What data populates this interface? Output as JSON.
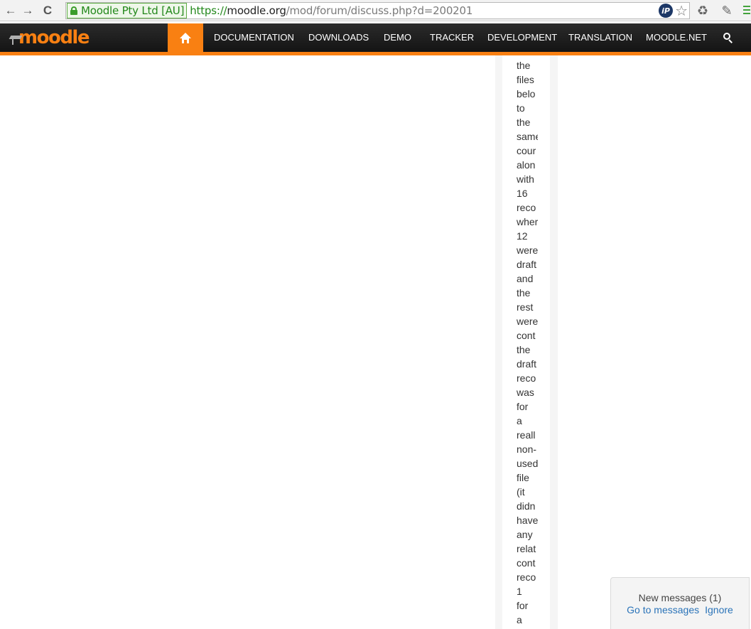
{
  "browser": {
    "ev_label": "Moodle Pty Ltd [AU]",
    "url_scheme": "https://",
    "url_host": "moodle.org",
    "url_path": "/mod/forum/discuss.php?d=200201",
    "buttons": {
      "back": "←",
      "forward": "→",
      "reload": "C"
    }
  },
  "site": {
    "logo_text": "moodle",
    "brand_color": "#f98012",
    "nav": [
      "DOCUMENTATION",
      "DOWNLOADS",
      "DEMO",
      "TRACKER",
      "DEVELOPMENT",
      "TRANSLATION",
      "MOODLE.NET"
    ]
  },
  "post": {
    "words": [
      "the",
      "files",
      "belo",
      "to",
      "the",
      "same",
      "cour",
      "alon",
      "with",
      "16",
      "reco",
      "wher",
      "12",
      "were",
      "draft",
      "and",
      "the",
      "rest",
      "were",
      "cont",
      "the",
      "draft",
      "reco",
      "was",
      "for",
      "a",
      "reall",
      "non-",
      "used",
      "file",
      "(it",
      "didn",
      "have",
      "any",
      "relat",
      "cont",
      "reco",
      "1",
      "for",
      "a"
    ]
  },
  "notification": {
    "title": "New messages (1)",
    "go_label": "Go to messages",
    "ignore_label": "Ignore"
  }
}
